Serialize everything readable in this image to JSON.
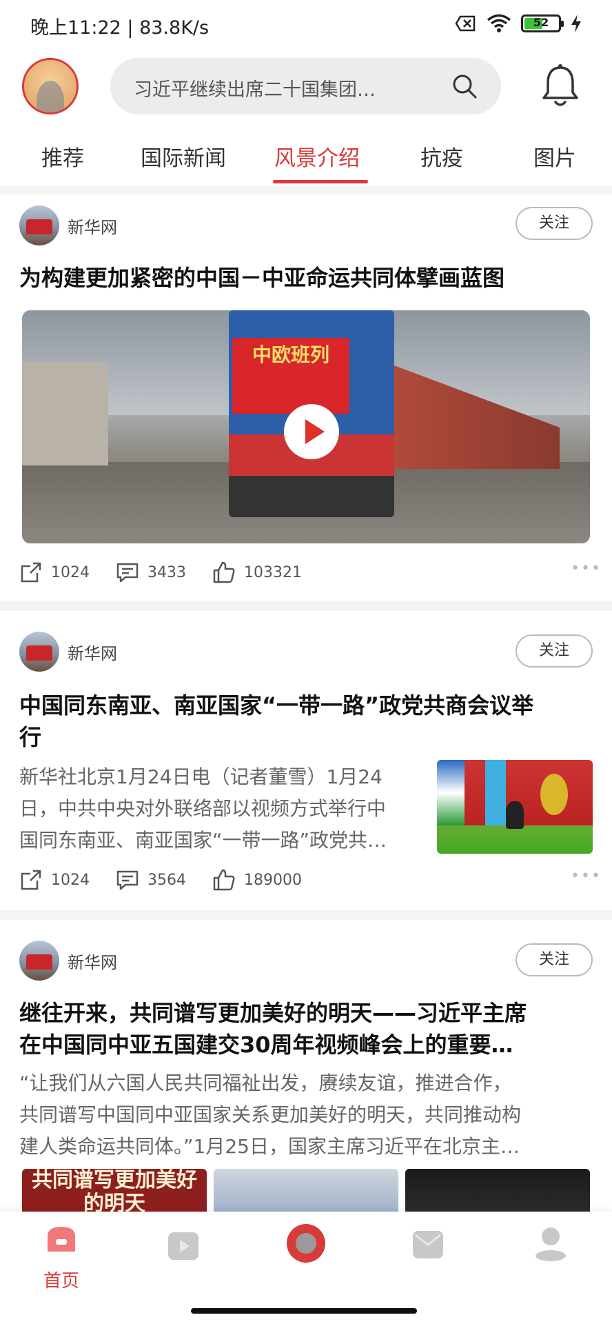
{
  "status_bar": {
    "time": "晚上11:22 | 83.8K/s",
    "battery": "52"
  },
  "header": {
    "search_placeholder": "习近平继续出席二十国集团…"
  },
  "tabs": [
    {
      "label": "推荐"
    },
    {
      "label": "国际新闻"
    },
    {
      "label": "风景介绍"
    },
    {
      "label": "抗疫"
    },
    {
      "label": "图片"
    }
  ],
  "feed": [
    {
      "source": "新华网",
      "follow": "关注",
      "title": "为构建更加紧密的中国－中亚命运共同体擘画蓝图",
      "video_banner": "中欧班列",
      "stats": {
        "share": "1024",
        "comment": "3433",
        "like": "103321"
      }
    },
    {
      "source": "新华网",
      "follow": "关注",
      "title_line1": "中国同东南亚、南亚国家“一带一路”政党共商会议举",
      "title_line2": "行",
      "summary_line1": "新华社北京1月24日电（记者董雪）1月24",
      "summary_line2": "日，中共中央对外联络部以视频方式举行中",
      "summary_line3": "国同东南亚、南亚国家“一带一路”政党共…",
      "stats": {
        "share": "1024",
        "comment": "3564",
        "like": "189000"
      }
    },
    {
      "source": "新华网",
      "follow": "关注",
      "title_line1": "继往开来，共同谱写更加美好的明天——习近平主席",
      "title_line2": "在中国同中亚五国建交30周年视频峰会上的重要…",
      "summary_line1": "“让我们从六国人民共同福祉出发，赓续友谊，推进合作，",
      "summary_line2": "共同谱写中国同中亚国家关系更加美好的明天，共同推动构",
      "summary_line3": "建人类命运共同体。”1月25日，国家主席习近平在北京主…",
      "image_caption": "共同谱写更加美好的明天"
    }
  ],
  "bottom_nav": {
    "home_label": "首页"
  },
  "colors": {
    "accent": "#d93a3a"
  }
}
